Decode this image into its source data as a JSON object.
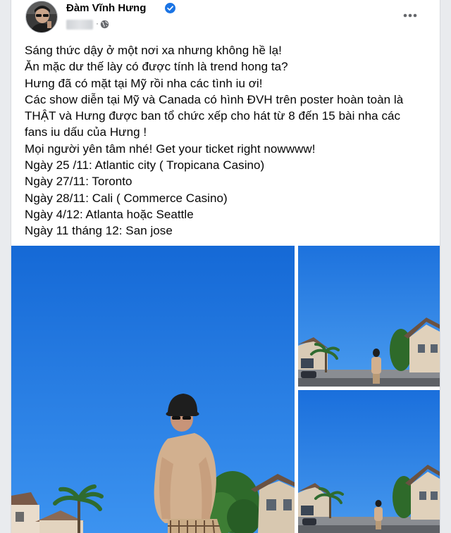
{
  "post": {
    "author": "Đàm Vĩnh Hưng",
    "text_lines": [
      "Sáng thức dậy ở một nơi xa nhưng không hề lạ!",
      "Ăn mặc dư thế lày có được tính là trend hong ta?",
      "Hưng đã có mặt tại Mỹ rồi nha các tình iu ơi!",
      "Các show diễn tại Mỹ và Canada có hình ĐVH trên poster hoàn toàn là",
      "THẬT và Hưng được ban tổ chức xếp cho hát từ 8 đến 15 bài nha các",
      "fans iu dấu của Hưng !",
      "Mọi người yên tâm nhé! Get your ticket right nowwww!",
      "Ngày 25 /11: Atlantic city ( Tropicana Casino)",
      "Ngày 27/11: Toronto",
      "Ngày 28/11: Cali ( Commerce Casino)",
      "Ngày 4/12: Atlanta hoặc Seattle",
      "Ngày 11 tháng 12: San jose"
    ]
  },
  "icons": {
    "verified": "verified-badge-icon",
    "privacy": "globe-icon",
    "more": "more-options-icon"
  },
  "colors": {
    "verified_blue": "#1b74e4",
    "sky": "#1f7fe6",
    "text": "#050505",
    "meta": "#65676b"
  }
}
